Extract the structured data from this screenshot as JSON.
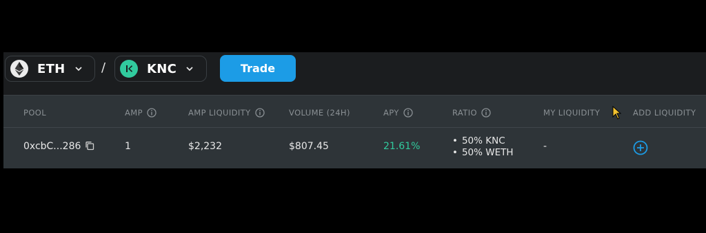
{
  "pair": {
    "base": {
      "symbol": "ETH",
      "icon": "eth-icon"
    },
    "separator": "/",
    "quote": {
      "symbol": "KNC",
      "icon": "knc-icon"
    }
  },
  "trade_label": "Trade",
  "table": {
    "headers": {
      "pool": "POOL",
      "amp": "AMP",
      "amp_liquidity": "AMP LIQUIDITY",
      "volume": "VOLUME (24H)",
      "apy": "APY",
      "ratio": "RATIO",
      "my_liquidity": "MY LIQUIDITY",
      "add_liquidity": "ADD LIQUIDITY"
    },
    "rows": [
      {
        "pool": "0xcbC...286",
        "amp": "1",
        "amp_liquidity": "$2,232",
        "volume": "$807.45",
        "apy": "21.61%",
        "ratio": [
          "50% KNC",
          "50% WETH"
        ],
        "my_liquidity": "-"
      }
    ]
  },
  "colors": {
    "accent": "#1c9ce6",
    "apy_green": "#31cb9e",
    "panel": "#1b1d1f",
    "table_bg": "#2e3438"
  }
}
